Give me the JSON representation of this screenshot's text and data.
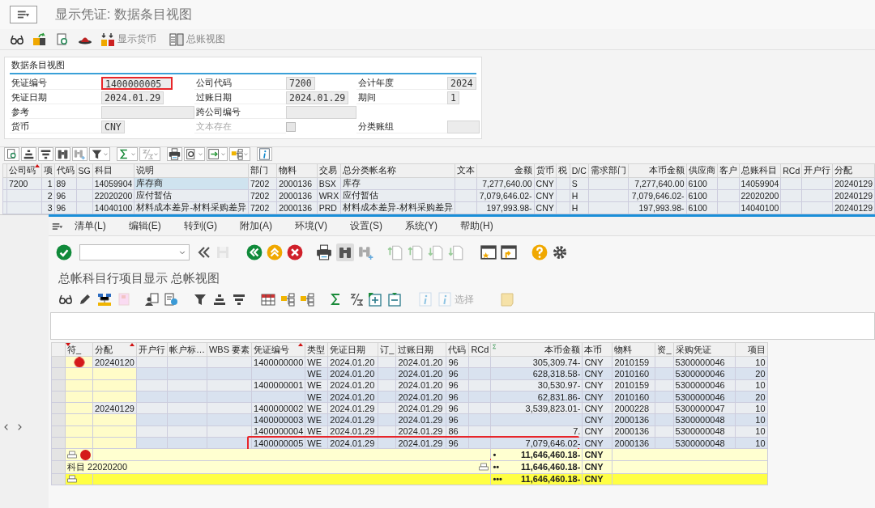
{
  "back_window": {
    "title": "显示凭证: 数据条目视图",
    "toolbar_buttons": [
      {
        "label": "显示货币"
      },
      {
        "label": "总账视图"
      }
    ],
    "header": {
      "title": "数据条目视图",
      "rows": [
        [
          {
            "kind": "field",
            "label": "凭证编号",
            "value": "1400000005",
            "highlighted": true
          },
          {
            "kind": "field",
            "label": "公司代码",
            "value": "7200",
            "highlighted": false
          },
          {
            "kind": "field",
            "label": "会计年度",
            "value": "2024",
            "highlighted": false
          }
        ],
        [
          {
            "kind": "field",
            "label": "凭证日期",
            "value": "2024.01.29",
            "highlighted": false
          },
          {
            "kind": "field",
            "label": "过账日期",
            "value": "2024.01.29",
            "highlighted": false
          },
          {
            "kind": "field",
            "label": "期间",
            "value": "1",
            "highlighted": false
          }
        ],
        [
          {
            "kind": "field",
            "label": "参考",
            "highlighted": false
          },
          {
            "kind": "field",
            "label": "跨公司编号",
            "highlighted": false
          }
        ],
        [
          {
            "kind": "field",
            "label": "货币",
            "value": "CNY",
            "highlighted": false
          },
          {
            "kind": "checkbox",
            "label": "文本存在",
            "checked": false,
            "disabled": true
          },
          {
            "kind": "field",
            "label": "分类账组",
            "highlighted": false
          }
        ]
      ]
    },
    "table": {
      "columns": [
        {
          "label": "公司码",
          "sorted": true
        },
        {
          "label": "项",
          "sorted": false
        },
        {
          "label": "代码",
          "sorted": false
        },
        {
          "label": "SG",
          "sorted": false
        },
        {
          "label": "科目",
          "sorted": false
        },
        {
          "label": "说明",
          "sorted": false
        },
        {
          "label": "部门",
          "sorted": false
        },
        {
          "label": "物料",
          "sorted": false
        },
        {
          "label": "交易",
          "sorted": false
        },
        {
          "label": "总分类帐名称",
          "sorted": false
        },
        {
          "label": "文本",
          "sorted": false
        },
        {
          "label": "金额",
          "sorted": false
        },
        {
          "label": "货币",
          "sorted": false
        },
        {
          "label": "税",
          "sorted": false
        },
        {
          "label": "D/C",
          "sorted": false
        },
        {
          "label": "需求部门",
          "sorted": false
        },
        {
          "label": "本币金额",
          "sorted": false
        },
        {
          "label": "供应商",
          "sorted": false
        },
        {
          "label": "客户",
          "sorted": false
        },
        {
          "label": "总账科目",
          "sorted": false
        },
        {
          "label": "RCd",
          "sorted": false
        },
        {
          "label": "开户行",
          "sorted": false
        },
        {
          "label": "分配",
          "sorted": false
        }
      ],
      "rows": [
        {
          "cells": [
            "7200",
            "1",
            "89",
            null,
            "14059904",
            "库存商",
            "7202",
            "2000136",
            "BSX",
            "库存",
            null,
            "7,277,640.00",
            "CNY",
            null,
            "S",
            null,
            "7,277,640.00",
            "6100",
            null,
            "14059904",
            null,
            null,
            "20240129"
          ]
        },
        {
          "cells": [
            null,
            "2",
            "96",
            null,
            "22020200",
            "应付暂估",
            "7202",
            "2000136",
            "WRX",
            "应付暂估",
            null,
            "7,079,646.02-",
            "CNY",
            null,
            "H",
            null,
            "7,079,646.02-",
            "6100",
            null,
            "22020200",
            null,
            null,
            "20240129"
          ]
        },
        {
          "cells": [
            null,
            "3",
            "96",
            null,
            "14040100",
            "材料成本差异-材料采购差异",
            "7202",
            "2000136",
            "PRD",
            "材料成本差异-材料采购差异",
            null,
            "197,993.98-",
            "CNY",
            null,
            "H",
            null,
            "197,993.98-",
            "6100",
            null,
            "14040100",
            null,
            null,
            "20240129"
          ]
        }
      ]
    }
  },
  "front_window": {
    "menu": [
      "清单(L)",
      "编辑(E)",
      "转到(G)",
      "附加(A)",
      "环境(V)",
      "设置(S)",
      "系统(Y)",
      "帮助(H)"
    ],
    "title": "总帐科目行项目显示 总帐视图",
    "toolbar_buttons": [
      {
        "label": "选择",
        "disabled": true
      }
    ],
    "table": {
      "columns": [
        {
          "label": "符_",
          "sorted": true,
          "summed": false
        },
        {
          "label": "分配",
          "sorted": true,
          "summed": false
        },
        {
          "label": "开户行",
          "sorted": false,
          "summed": false
        },
        {
          "label": "帐户标…",
          "sorted": false,
          "summed": false
        },
        {
          "label": "WBS 要素",
          "sorted": false,
          "summed": false
        },
        {
          "label": "凭证编号",
          "sorted": true,
          "summed": false
        },
        {
          "label": "类型",
          "sorted": false,
          "summed": false
        },
        {
          "label": "凭证日期",
          "sorted": false,
          "summed": false
        },
        {
          "label": "订_",
          "sorted": false,
          "summed": false
        },
        {
          "label": "过账日期",
          "sorted": false,
          "summed": false
        },
        {
          "label": "代码",
          "sorted": false,
          "summed": false
        },
        {
          "label": "RCd",
          "sorted": false,
          "summed": false
        },
        {
          "label": "本币金额",
          "sorted": false,
          "summed": true
        },
        {
          "label": "本币",
          "sorted": false,
          "summed": false
        },
        {
          "label": "物料",
          "sorted": false,
          "summed": false
        },
        {
          "label": "资_",
          "sorted": false,
          "summed": false
        },
        {
          "label": "采购凭证",
          "sorted": false,
          "summed": false
        },
        {
          "label": "项目",
          "sorted": false,
          "summed": false
        }
      ],
      "rows": [
        {
          "kind": "item",
          "alert": true,
          "highlighted": false,
          "cells": [
            "20240120",
            null,
            null,
            null,
            "1400000000",
            "WE",
            "2024.01.20",
            null,
            "2024.01.20",
            "96",
            null,
            "305,309.74-",
            "CNY",
            "2010159",
            null,
            "5300000046",
            "10"
          ]
        },
        {
          "kind": "item",
          "alert": false,
          "highlighted": false,
          "cells": [
            null,
            null,
            null,
            null,
            null,
            "WE",
            "2024.01.20",
            null,
            "2024.01.20",
            "96",
            null,
            "628,318.58-",
            "CNY",
            "2010160",
            null,
            "5300000046",
            "20"
          ]
        },
        {
          "kind": "item",
          "alert": false,
          "highlighted": false,
          "cells": [
            null,
            null,
            null,
            null,
            "1400000001",
            "WE",
            "2024.01.20",
            null,
            "2024.01.20",
            "96",
            null,
            "30,530.97-",
            "CNY",
            "2010159",
            null,
            "5300000046",
            "10"
          ]
        },
        {
          "kind": "item",
          "alert": false,
          "highlighted": false,
          "cells": [
            null,
            null,
            null,
            null,
            null,
            "WE",
            "2024.01.20",
            null,
            "2024.01.20",
            "96",
            null,
            "62,831.86-",
            "CNY",
            "2010160",
            null,
            "5300000046",
            "20"
          ]
        },
        {
          "kind": "item",
          "alert": false,
          "highlighted": false,
          "cells": [
            "20240129",
            null,
            null,
            null,
            "1400000002",
            "WE",
            "2024.01.29",
            null,
            "2024.01.29",
            "96",
            null,
            "3,539,823.01-",
            "CNY",
            "2000228",
            null,
            "5300000047",
            "10"
          ]
        },
        {
          "kind": "item",
          "alert": false,
          "highlighted": false,
          "cells": [
            null,
            null,
            null,
            null,
            "1400000003",
            "WE",
            "2024.01.29",
            null,
            "2024.01.29",
            "96",
            null,
            null,
            "CNY",
            "2000136",
            null,
            "5300000048",
            "10"
          ]
        },
        {
          "kind": "item",
          "alert": false,
          "highlighted": false,
          "cells": [
            null,
            null,
            null,
            null,
            "1400000004",
            "WE",
            "2024.01.29",
            null,
            "2024.01.29",
            "86",
            null,
            "7.",
            "CNY",
            "2000136",
            null,
            "5300000048",
            "10"
          ]
        },
        {
          "kind": "item",
          "alert": false,
          "highlighted": true,
          "cells": [
            null,
            null,
            null,
            null,
            "1400000005",
            "WE",
            "2024.01.29",
            null,
            "2024.01.29",
            "96",
            null,
            "7,079,646.02-",
            "CNY",
            "2000136",
            null,
            "5300000048",
            "10"
          ]
        },
        {
          "kind": "subtotal",
          "alert": true,
          "marks": "•",
          "amount": "11,646,460.18-",
          "currency": "CNY"
        },
        {
          "kind": "subtotal",
          "alert": false,
          "label": "科目 22020200",
          "marks": "••",
          "amount": "11,646,460.18-",
          "currency": "CNY"
        },
        {
          "kind": "total",
          "alert": false,
          "marks": "•••",
          "amount": "11,646,460.18-",
          "currency": "CNY"
        }
      ]
    }
  }
}
